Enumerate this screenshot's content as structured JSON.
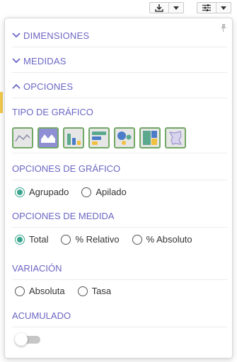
{
  "toolbar": {
    "download": {
      "icon": "download-icon",
      "menu_icon": "caret-down-icon"
    },
    "settings": {
      "icon": "sliders-icon",
      "menu_icon": "caret-down-icon"
    }
  },
  "panel": {
    "pin_icon": "pin-icon",
    "sections": {
      "dimensiones": {
        "label": "DIMENSIONES",
        "expanded": false
      },
      "medidas": {
        "label": "MEDIDAS",
        "expanded": false
      },
      "opciones": {
        "label": "OPCIONES",
        "expanded": true
      }
    },
    "tipo_grafico": {
      "label": "TIPO DE GRÁFICO",
      "types": [
        {
          "name": "line",
          "selected": false
        },
        {
          "name": "area",
          "selected": true
        },
        {
          "name": "bar",
          "selected": false
        },
        {
          "name": "horizontal-bar",
          "selected": false
        },
        {
          "name": "bubble",
          "selected": false
        },
        {
          "name": "treemap",
          "selected": false
        },
        {
          "name": "map",
          "selected": false
        }
      ]
    },
    "opciones_grafico": {
      "label": "OPCIONES DE GRÁFICO",
      "options": [
        "Agrupado",
        "Apilado"
      ],
      "selected": "Agrupado"
    },
    "opciones_medida": {
      "label": "OPCIONES DE MEDIDA",
      "options": [
        "Total",
        "% Relativo",
        "% Absoluto"
      ],
      "selected": "Total"
    },
    "variacion": {
      "label": "VARIACIÓN",
      "options": [
        "Absoluta",
        "Tasa"
      ],
      "selected": null
    },
    "acumulado": {
      "label": "ACUMULADO",
      "enabled": false
    }
  },
  "colors": {
    "accent": "#6b66c4",
    "radio": "#3aa58f",
    "icon_border": "#72a866",
    "selected_type_bg": "#8f8fd6"
  }
}
